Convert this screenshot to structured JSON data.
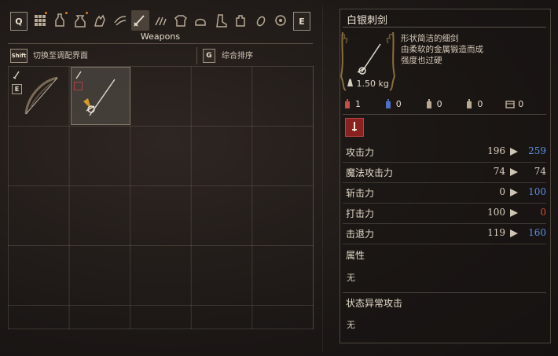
{
  "category_bar": {
    "left_key": "Q",
    "right_key": "E",
    "title": "Weapons",
    "icons": [
      "grid-icon",
      "potion-icon",
      "pouch-icon",
      "hand-icon",
      "scroll-icon",
      "sword-icon",
      "claw-icon",
      "armor-icon",
      "helmet-icon",
      "boot-icon",
      "gauntlet-icon",
      "ring-icon"
    ]
  },
  "sort_row": {
    "shift_key": "Shift",
    "shift_label": "切换至调配界面",
    "g_key": "G",
    "g_label": "综合排序"
  },
  "inventory": {
    "slots": [
      {
        "item": "bow",
        "equipped_badge": "E"
      },
      {
        "item": "white-silver-rapier",
        "selected": true
      }
    ]
  },
  "detail": {
    "name": "白银刺剑",
    "description": [
      "形状简洁的细剑",
      "由柔软的金属锻造而成",
      "强度也过硬"
    ],
    "weight": "1.50 kg",
    "resistances": [
      {
        "icon": "fire-res-icon",
        "value": "1",
        "color": "#c0504a"
      },
      {
        "icon": "ice-res-icon",
        "value": "0",
        "color": "#4f6fbf"
      },
      {
        "icon": "holy-res-icon",
        "value": "0",
        "color": "#b8aa95"
      },
      {
        "icon": "dark-res-icon",
        "value": "0",
        "color": "#b8aa95"
      },
      {
        "icon": "chest-res-icon",
        "value": "0",
        "color": "#b8aa95"
      }
    ],
    "stats": [
      {
        "label": "攻击力",
        "current": "196",
        "new": "259",
        "new_color": "#5c8fe0"
      },
      {
        "label": "魔法攻击力",
        "current": "74",
        "new": "74",
        "new_color": "#ddd2c1"
      },
      {
        "label": "斩击力",
        "current": "0",
        "new": "100",
        "new_color": "#5c8fe0"
      },
      {
        "label": "打击力",
        "current": "100",
        "new": "0",
        "new_color": "#d0502f"
      },
      {
        "label": "击退力",
        "current": "119",
        "new": "160",
        "new_color": "#5c8fe0"
      }
    ],
    "attribute_label": "属性",
    "attribute_value": "无",
    "status_label": "状态异常攻击",
    "status_value": "无"
  }
}
